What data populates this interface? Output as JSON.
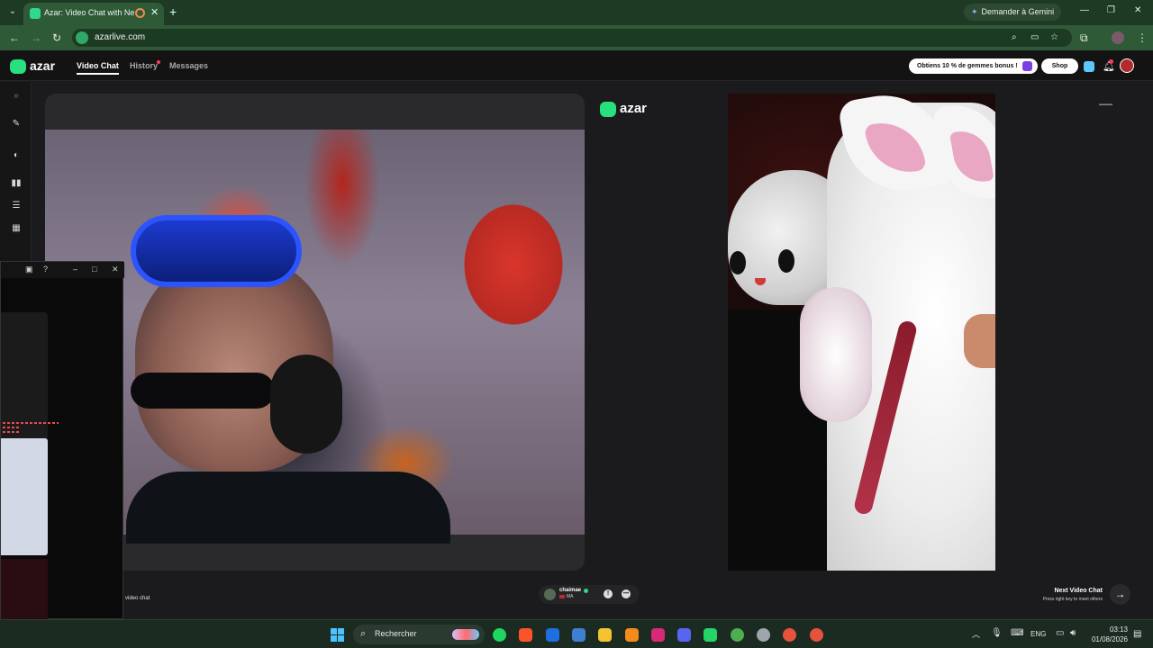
{
  "browser": {
    "tab_title": "Azar: Video Chat with New",
    "url": "azarlive.com",
    "gemini_button": "Demander à Gemini",
    "icons": [
      "tab-search-icon",
      "record-icon",
      "close-icon",
      "new-tab-icon",
      "back-icon",
      "forward-icon",
      "reload-icon",
      "zoom-icon",
      "cast-icon",
      "star-icon",
      "extensions-icon",
      "profile-icon",
      "menu-icon"
    ]
  },
  "app": {
    "logo": "azar",
    "nav": {
      "video_chat": "Video Chat",
      "history": "History",
      "messages": "Messages"
    },
    "promo": "Obtiens 10 % de gemmes bonus !",
    "shop": "Shop"
  },
  "popup": {
    "icons": [
      "screenshot-icon",
      "help-icon",
      "minimize-icon",
      "maximize-icon",
      "close-icon"
    ]
  },
  "center_logo": "azar",
  "bottom": {
    "left_text": "video chat",
    "peer_name": "chaimae",
    "peer_country": "MA",
    "next_title": "Next Video Chat",
    "next_subtitle": "Press right key to meet others"
  },
  "taskbar": {
    "search_placeholder": "Rechercher",
    "language": "ENG",
    "time": "03:13",
    "date": "01/08/2026",
    "apps": [
      "spotify",
      "brave",
      "security",
      "store",
      "file-explorer",
      "vlc",
      "instagram",
      "discord",
      "whatsapp",
      "chrome",
      "steam",
      "chrome-profile-2",
      "chrome-profile-3"
    ],
    "colors": {
      "spotify": "#1ed760",
      "brave": "#fb542b",
      "security": "#1d6fe0",
      "store": "#3f7fd1",
      "file-explorer": "#f4c430",
      "vlc": "#f28c1a",
      "instagram": "#d62976",
      "discord": "#5865f2",
      "whatsapp": "#25d366",
      "chrome": "#4caf50",
      "steam": "#9ea5ad",
      "chrome-profile-2": "#e5533d",
      "chrome-profile-3": "#e5533d"
    }
  }
}
